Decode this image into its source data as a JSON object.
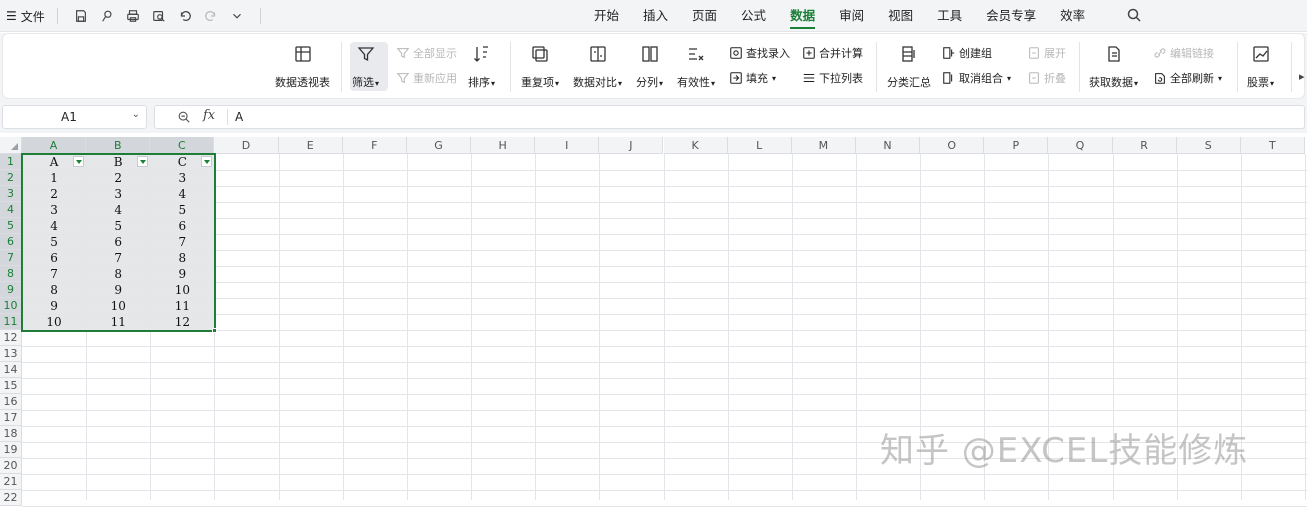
{
  "menubar": {
    "file_label": "文件",
    "tabs": [
      {
        "label": "开始",
        "active": false
      },
      {
        "label": "插入",
        "active": false
      },
      {
        "label": "页面",
        "active": false
      },
      {
        "label": "公式",
        "active": false
      },
      {
        "label": "数据",
        "active": true
      },
      {
        "label": "审阅",
        "active": false
      },
      {
        "label": "视图",
        "active": false
      },
      {
        "label": "工具",
        "active": false
      },
      {
        "label": "会员专享",
        "active": false
      },
      {
        "label": "效率",
        "active": false
      }
    ]
  },
  "ribbon": {
    "pivot": "数据透视表",
    "filter": "筛选",
    "show_all": "全部显示",
    "reapply": "重新应用",
    "sort": "排序",
    "duplicates": "重复项",
    "compare": "数据对比",
    "split": "分列",
    "validation": "有效性",
    "lookup_entry": "查找录入",
    "fill": "填充",
    "consolidate": "合并计算",
    "dropdown_list": "下拉列表",
    "subtotal": "分类汇总",
    "group": "创建组",
    "ungroup": "取消组合",
    "expand": "展开",
    "collapse": "折叠",
    "get_data": "获取数据",
    "edit_links": "编辑链接",
    "refresh_all": "全部刷新",
    "stocks": "股票"
  },
  "formula_bar": {
    "name_box": "A1",
    "fx": "fx",
    "value": "A"
  },
  "sheet": {
    "columns": [
      "A",
      "B",
      "C",
      "D",
      "E",
      "F",
      "G",
      "H",
      "I",
      "J",
      "K",
      "L",
      "M",
      "N",
      "O",
      "P",
      "Q",
      "R",
      "S",
      "T"
    ],
    "rows": [
      "1",
      "2",
      "3",
      "4",
      "5",
      "6",
      "7",
      "8",
      "9",
      "10",
      "11",
      "12",
      "13",
      "14",
      "15",
      "16",
      "17",
      "18",
      "19",
      "20",
      "21",
      "22"
    ],
    "data": [
      [
        "A",
        "B",
        "C"
      ],
      [
        "1",
        "2",
        "3"
      ],
      [
        "2",
        "3",
        "4"
      ],
      [
        "3",
        "4",
        "5"
      ],
      [
        "4",
        "5",
        "6"
      ],
      [
        "5",
        "6",
        "7"
      ],
      [
        "6",
        "7",
        "8"
      ],
      [
        "7",
        "8",
        "9"
      ],
      [
        "8",
        "9",
        "10"
      ],
      [
        "9",
        "10",
        "11"
      ],
      [
        "10",
        "11",
        "12"
      ]
    ],
    "selected_range": "A1:C11"
  },
  "watermark": "知乎 @EXCEL技能修炼",
  "colors": {
    "accent": "#1a7f37",
    "selection_border": "#1e7d36"
  }
}
